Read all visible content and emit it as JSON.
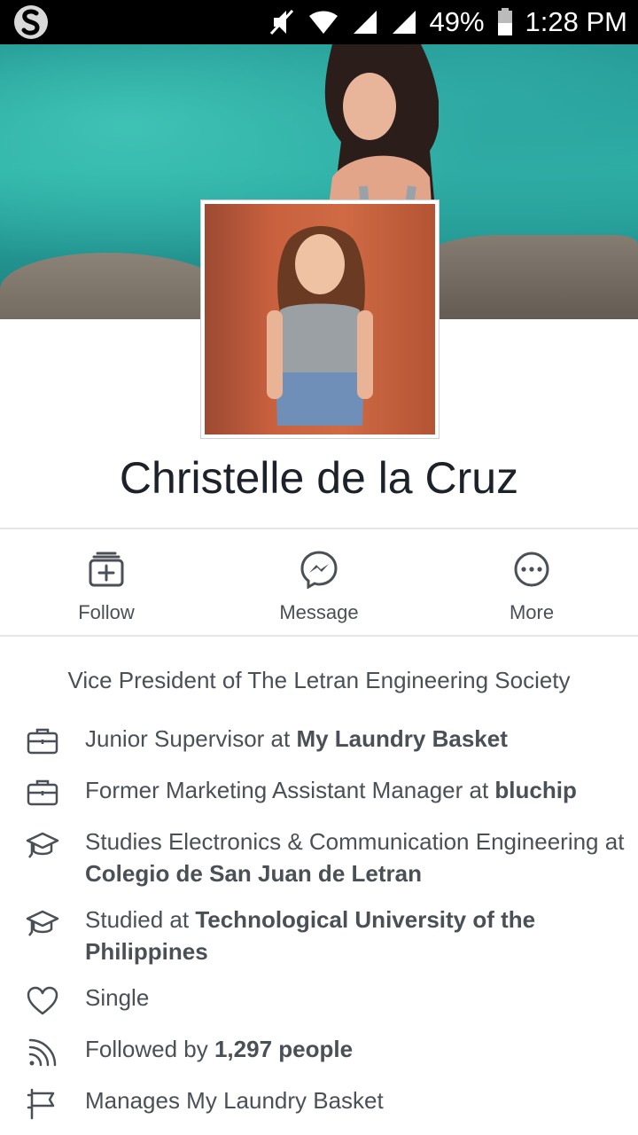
{
  "status_bar": {
    "battery_percent": "49%",
    "time": "1:28 PM"
  },
  "profile": {
    "name": "Christelle de la Cruz"
  },
  "actions": [
    {
      "label": "Follow",
      "icon": "follow-icon"
    },
    {
      "label": "Message",
      "icon": "messenger-icon"
    },
    {
      "label": "More",
      "icon": "more-icon"
    }
  ],
  "intro": {
    "headline": "Vice President of The Letran Engineering Society",
    "items": [
      {
        "icon": "briefcase-icon",
        "prefix": "Junior Supervisor at ",
        "bold": "My Laundry Basket"
      },
      {
        "icon": "briefcase-icon",
        "prefix": "Former Marketing Assistant Manager at ",
        "bold": "bluchip"
      },
      {
        "icon": "graduation-cap-icon",
        "prefix": "Studies Electronics & Communication Engineering at ",
        "bold": "Colegio de San Juan de Letran"
      },
      {
        "icon": "graduation-cap-icon",
        "prefix": "Studied at ",
        "bold": "Technological University of the Philippines"
      },
      {
        "icon": "heart-icon",
        "prefix": "Single",
        "bold": ""
      },
      {
        "icon": "rss-icon",
        "prefix": "Followed by ",
        "bold": "1,297 people"
      },
      {
        "icon": "flag-icon",
        "prefix": "Manages My Laundry Basket",
        "bold": ""
      }
    ]
  }
}
